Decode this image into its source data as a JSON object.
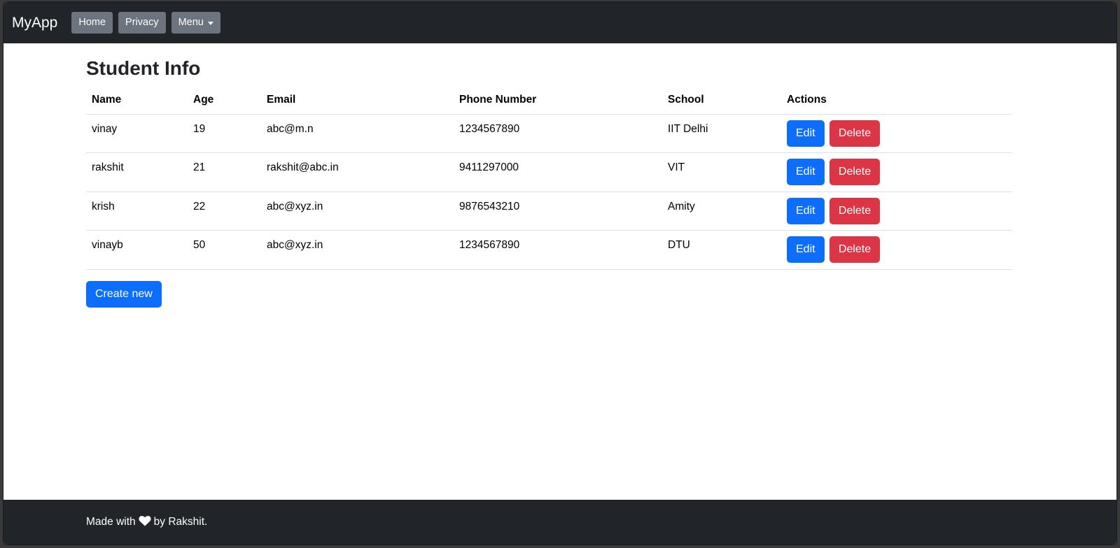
{
  "navbar": {
    "brand": "MyApp",
    "items": [
      {
        "label": "Home"
      },
      {
        "label": "Privacy"
      },
      {
        "label": "Menu"
      }
    ]
  },
  "page": {
    "title": "Student Info",
    "create_label": "Create new"
  },
  "table": {
    "headers": [
      "Name",
      "Age",
      "Email",
      "Phone Number",
      "School",
      "Actions"
    ],
    "rows": [
      {
        "name": "vinay",
        "age": "19",
        "email": "abc@m.n",
        "phone": "1234567890",
        "school": "IIT Delhi"
      },
      {
        "name": "rakshit",
        "age": "21",
        "email": "rakshit@abc.in",
        "phone": "9411297000",
        "school": "VIT"
      },
      {
        "name": "krish",
        "age": "22",
        "email": "abc@xyz.in",
        "phone": "9876543210",
        "school": "Amity"
      },
      {
        "name": "vinayb",
        "age": "50",
        "email": "abc@xyz.in",
        "phone": "1234567890",
        "school": "DTU"
      }
    ],
    "edit_label": "Edit",
    "delete_label": "Delete"
  },
  "footer": {
    "prefix": "Made with",
    "icon": "heart-icon",
    "suffix": "by Rakshit."
  },
  "colors": {
    "navbar_bg": "#212529",
    "primary": "#0d6efd",
    "danger": "#dc3545",
    "secondary": "#6c757d"
  }
}
